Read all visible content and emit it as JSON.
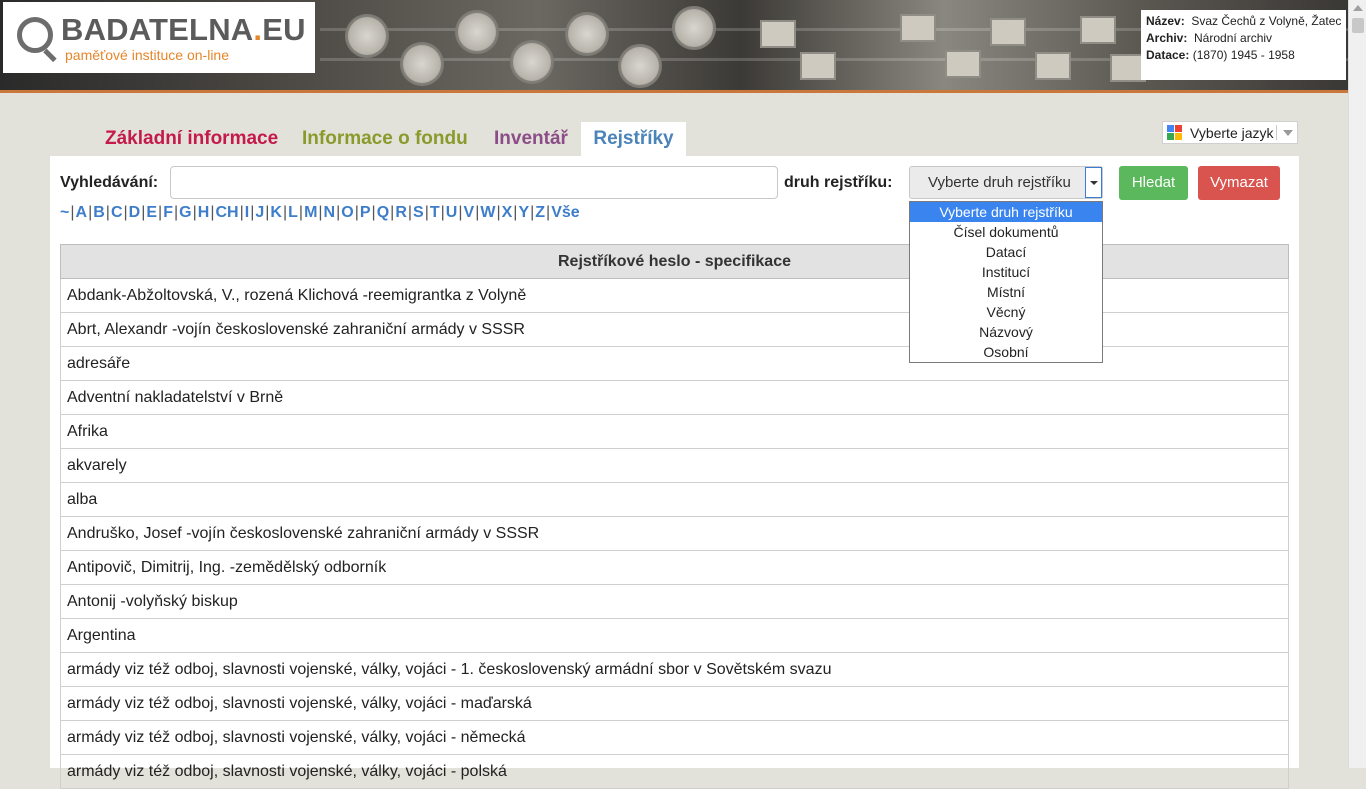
{
  "header": {
    "logo_name": "BADATELNA",
    "logo_dot": ".",
    "logo_suffix": "EU",
    "logo_tagline": "paměťové instituce on-line",
    "info": {
      "nazev_label": "Název:",
      "nazev_value": "Svaz Čechů z Volyně, Žatec",
      "archiv_label": "Archiv:",
      "archiv_value": "Národní archiv",
      "datace_label": "Datace:",
      "datace_value": "(1870) 1945 - 1958"
    }
  },
  "language": {
    "label": "Vyberte jazyk"
  },
  "tabs": [
    {
      "label": "Základní informace",
      "color": "#c4194b"
    },
    {
      "label": "Informace o fondu",
      "color": "#8a9a2b"
    },
    {
      "label": "Inventář",
      "color": "#8b4d87"
    },
    {
      "label": "Rejstříky",
      "color": "#4a84b8",
      "active": true
    }
  ],
  "search": {
    "label": "Vyhledávání:",
    "value": "",
    "type_label": "druh rejstříku:",
    "type_selected": "Vyberte druh rejstříku",
    "type_options": [
      "Vyberte druh rejstříku",
      "Čísel dokumentů",
      "Datací",
      "Institucí",
      "Místní",
      "Věcný",
      "Názvový",
      "Osobní"
    ],
    "search_button": "Hledat",
    "clear_button": "Vymazat"
  },
  "alphabet": [
    "~",
    "A",
    "B",
    "C",
    "D",
    "E",
    "F",
    "G",
    "H",
    "CH",
    "I",
    "J",
    "K",
    "L",
    "M",
    "N",
    "O",
    "P",
    "Q",
    "R",
    "S",
    "T",
    "U",
    "V",
    "W",
    "X",
    "Y",
    "Z",
    "Vše"
  ],
  "table": {
    "header": "Rejstříkové heslo - specifikace",
    "rows": [
      "Abdank-Abžoltovská, V., rozená Klichová -reemigrantka z Volyně",
      "Abrt, Alexandr -vojín československé zahraniční armády v SSSR",
      "adresáře",
      "Adventní nakladatelství v Brně",
      "Afrika",
      "akvarely",
      "alba",
      "Andruško, Josef -vojín československé zahraniční armády v SSSR",
      "Antipovič, Dimitrij, Ing. -zemědělský odborník",
      "Antonij -volyňský biskup",
      "Argentina",
      "armády viz též odboj, slavnosti vojenské, války, vojáci - 1. československý armádní sbor v Sovětském svazu",
      "armády viz též odboj, slavnosti vojenské, války, vojáci - maďarská",
      "armády viz též odboj, slavnosti vojenské, války, vojáci - německá",
      "armády viz též odboj, slavnosti vojenské, války, vojáci - polská"
    ]
  },
  "colors": {
    "accent_orange": "#e5862a",
    "tab_active": "#4a84b8",
    "search_button": "#5cb85c",
    "clear_button": "#d9534f",
    "selected_option": "#3a84f0"
  }
}
